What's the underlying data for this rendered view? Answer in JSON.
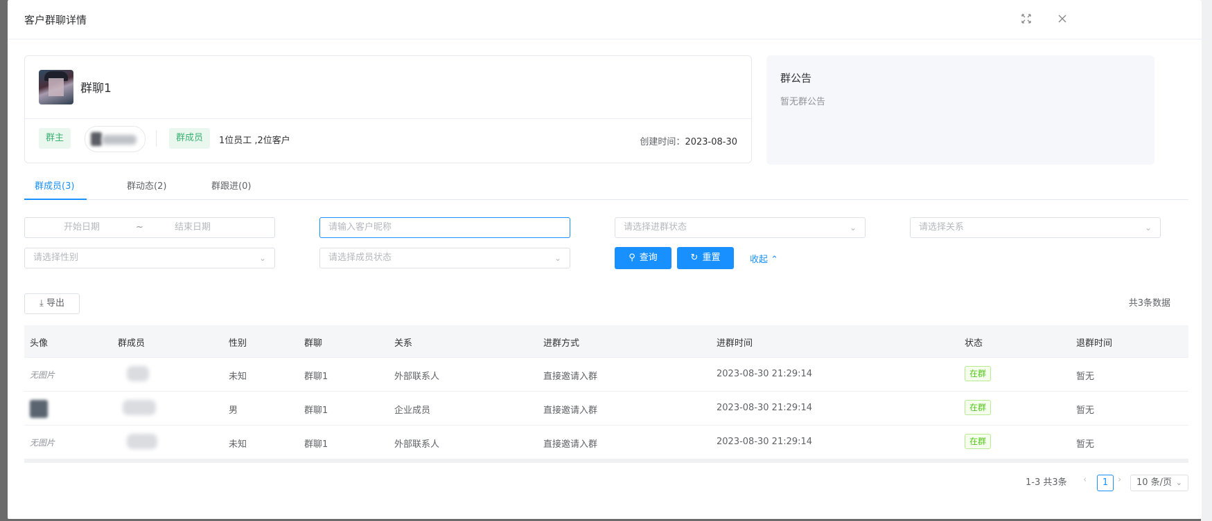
{
  "dialog": {
    "title": "客户群聊详情"
  },
  "group": {
    "name": "群聊1",
    "owner_label": "群主",
    "members_label": "群成员",
    "member_summary": "1位员工 ,2位客户",
    "created_label": "创建时间：",
    "created_date": "2023-08-30"
  },
  "notice": {
    "title": "群公告",
    "body": "暂无群公告"
  },
  "tabs": [
    {
      "label": "群成员(3)",
      "active": true
    },
    {
      "label": "群动态(2)",
      "active": false
    },
    {
      "label": "群跟进(0)",
      "active": false
    }
  ],
  "filters": {
    "start_date": "开始日期",
    "date_sep": "~",
    "end_date": "结束日期",
    "nickname_placeholder": "请输入客户昵称",
    "join_status": "请选择进群状态",
    "relation": "请选择关系",
    "gender": "请选择性别",
    "member_status": "请选择成员状态",
    "search_label": "查询",
    "reset_label": "重置",
    "collapse_label": "收起"
  },
  "toolbar": {
    "export_label": "导出",
    "total": "共3条数据"
  },
  "table": {
    "columns": [
      "头像",
      "群成员",
      "性别",
      "群聊",
      "关系",
      "进群方式",
      "进群时间",
      "状态",
      "退群时间"
    ],
    "rows": [
      {
        "avatar": "无图片",
        "gender": "未知",
        "chat": "群聊1",
        "relation": "外部联系人",
        "join_method": "直接邀请入群",
        "join_time": "2023-08-30 21:29:14",
        "status": "在群",
        "quit_time": "暂无"
      },
      {
        "avatar": "",
        "gender": "男",
        "chat": "群聊1",
        "relation": "企业成员",
        "join_method": "直接邀请入群",
        "join_time": "2023-08-30 21:29:14",
        "status": "在群",
        "quit_time": "暂无"
      },
      {
        "avatar": "无图片",
        "gender": "未知",
        "chat": "群聊1",
        "relation": "外部联系人",
        "join_method": "直接邀请入群",
        "join_time": "2023-08-30 21:29:14",
        "status": "在群",
        "quit_time": "暂无"
      }
    ]
  },
  "pagination": {
    "range": "1-3 共3条",
    "current": "1",
    "page_size": "10 条/页"
  },
  "colors": {
    "primary": "#1890ff",
    "green_tag": "#3bb273",
    "status_green": "#52c41a"
  }
}
